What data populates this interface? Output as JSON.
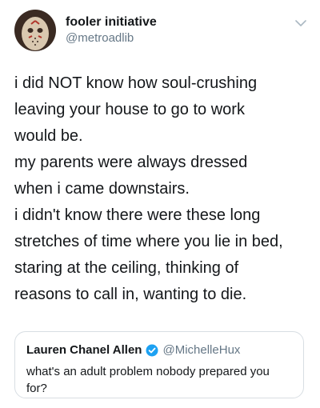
{
  "tweet": {
    "author": {
      "display_name": "fooler initiative",
      "handle": "@metroadlib",
      "avatar_icon": "hockey-mask-avatar"
    },
    "menu_icon": "chevron-down-icon",
    "text_lines": [
      "i did NOT know how soul-crushing",
      "leaving your house to go to work",
      "would be.",
      "my parents were always dressed",
      "when i came downstairs.",
      "i didn't know there were these long",
      "stretches of time where you lie in bed,",
      "staring at the ceiling, thinking of",
      "reasons to call in, wanting to die."
    ],
    "quoted_tweet": {
      "display_name": "Lauren Chanel Allen",
      "verified_icon": "verified-badge-icon",
      "handle": "@MichelleHux",
      "text": "what's an adult problem nobody prepared you for?"
    }
  },
  "colors": {
    "text_primary": "#14171a",
    "text_secondary": "#657786",
    "verified_blue": "#1da1f2",
    "card_border": "#d8dee3"
  }
}
